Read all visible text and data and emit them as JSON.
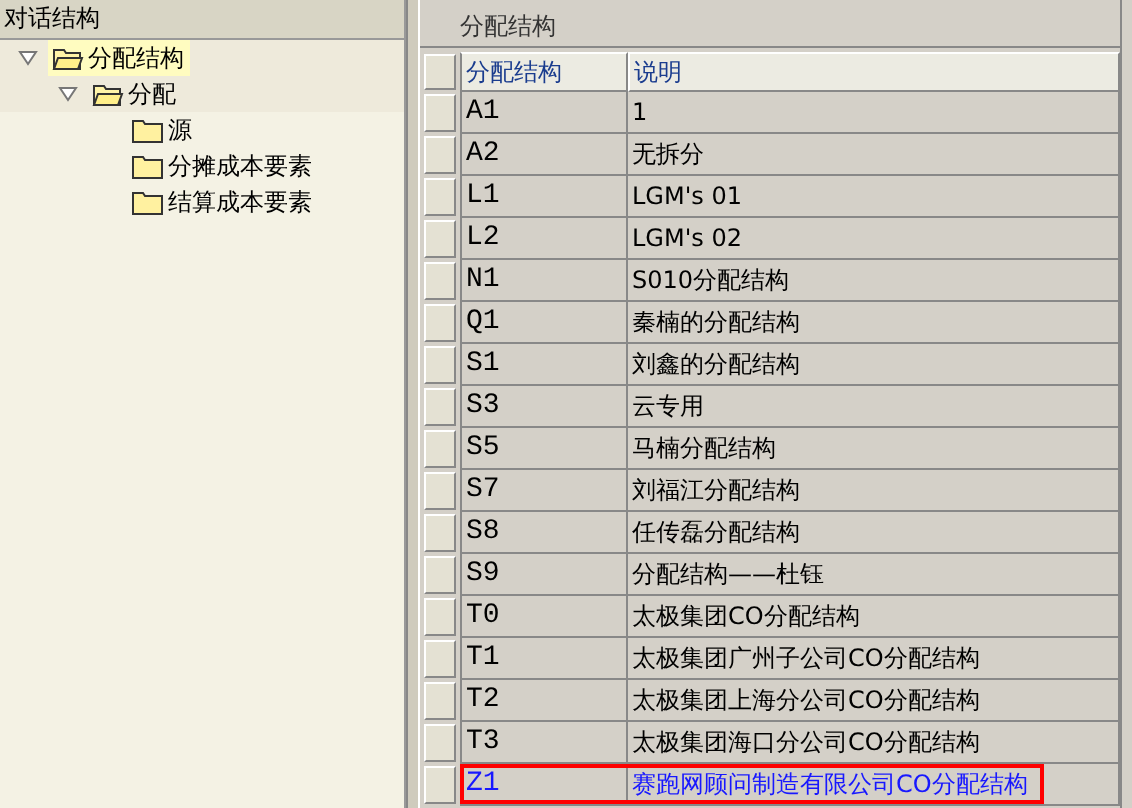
{
  "dialog_structure": {
    "title": "对话结构",
    "tree": [
      {
        "label": "分配结构",
        "expanded": true,
        "selected": true,
        "children": [
          {
            "label": "分配",
            "expanded": true,
            "selected": false,
            "children": [
              {
                "label": "源",
                "selected": false
              },
              {
                "label": "分摊成本要素",
                "selected": false
              },
              {
                "label": "结算成本要素",
                "selected": false
              }
            ]
          }
        ]
      }
    ]
  },
  "table_panel": {
    "title": "分配结构",
    "columns": [
      "分配结构",
      "说明"
    ],
    "rows": [
      {
        "code": "A1",
        "description": "1",
        "selected": false
      },
      {
        "code": "A2",
        "description": "无拆分",
        "selected": false
      },
      {
        "code": "L1",
        "description": "LGM's 01",
        "selected": false
      },
      {
        "code": "L2",
        "description": "LGM's 02",
        "selected": false
      },
      {
        "code": "N1",
        "description": "S010分配结构",
        "selected": false
      },
      {
        "code": "Q1",
        "description": "秦楠的分配结构",
        "selected": false
      },
      {
        "code": "S1",
        "description": "刘鑫的分配结构",
        "selected": false
      },
      {
        "code": "S3",
        "description": "云专用",
        "selected": false
      },
      {
        "code": "S5",
        "description": "马楠分配结构",
        "selected": false
      },
      {
        "code": "S7",
        "description": "刘福江分配结构",
        "selected": false
      },
      {
        "code": "S8",
        "description": "任传磊分配结构",
        "selected": false
      },
      {
        "code": "S9",
        "description": "分配结构——杜钰",
        "selected": false
      },
      {
        "code": "T0",
        "description": "太极集团CO分配结构",
        "selected": false
      },
      {
        "code": "T1",
        "description": "太极集团广州子公司CO分配结构",
        "selected": false
      },
      {
        "code": "T2",
        "description": "太极集团上海分公司CO分配结构",
        "selected": false
      },
      {
        "code": "T3",
        "description": "太极集团海口分公司CO分配结构",
        "selected": false
      },
      {
        "code": "Z1",
        "description": "赛跑网顾问制造有限公司CO分配结构",
        "selected": true
      }
    ]
  }
}
